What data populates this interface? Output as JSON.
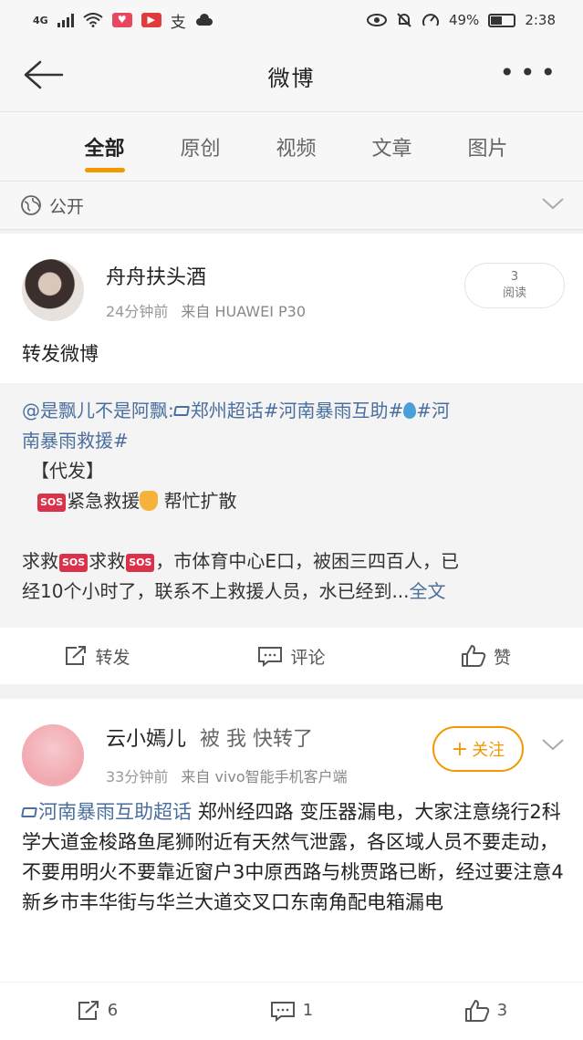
{
  "status_bar": {
    "network": "4G",
    "battery": "49%",
    "time": "2:38"
  },
  "nav": {
    "title": "微博",
    "more": "•••"
  },
  "tabs": [
    {
      "label": "全部",
      "active": true
    },
    {
      "label": "原创",
      "active": false
    },
    {
      "label": "视频",
      "active": false
    },
    {
      "label": "文章",
      "active": false
    },
    {
      "label": "图片",
      "active": false
    }
  ],
  "visibility": {
    "label": "公开"
  },
  "post1": {
    "username": "舟舟扶头酒",
    "time": "24分钟前",
    "source": "来自 HUAWEI P30",
    "read_count": "3",
    "read_label": "阅读",
    "text": "转发微博",
    "quoted": {
      "mention": "@是飘儿不是阿飘",
      "colon": ":",
      "topic_super": "郑州超话",
      "tag1": "#河南暴雨互助#",
      "tag2_a": "#河",
      "tag2_b": "南暴雨救援#",
      "line_bracket": "【代发】",
      "line_help_a": "紧急救援",
      "line_help_b": "帮忙扩散",
      "body_a": "求救",
      "body_b": "求救",
      "body_c": "，市体育中心E口，被困三四百人，已",
      "body_d": "经10个小时了，联系不上救援人员，水已经到...",
      "full_text": "全文",
      "sos": "SOS"
    },
    "actions": {
      "repost": "转发",
      "comment": "评论",
      "like": "赞"
    }
  },
  "post2": {
    "username": "云小嫣儿",
    "suffix": "被 我 快转了",
    "time": "33分钟前",
    "source": "来自 vivo智能手机客户端",
    "follow": "关注",
    "topic": "河南暴雨互助超话",
    "body": "郑州经四路 变压器漏电，大家注意绕行2科学大道金梭路鱼尾狮附近有天然气泄露，各区域人员不要走动，不要用明火不要靠近窗户3中原西路与桃贾路已断，经过要注意4新乡市丰华街与华兰大道交叉口东南角配电箱漏电",
    "actions": {
      "repost_count": "6",
      "comment_count": "1",
      "like_count": "3"
    }
  },
  "colors": {
    "accent": "#f39800",
    "link": "#4a6f9f",
    "sos": "#d9334c"
  },
  "icons": [
    "back-arrow-icon",
    "more-icon",
    "globe-icon",
    "chevron-down-icon",
    "repost-icon",
    "comment-icon",
    "like-icon",
    "diamond-topic-icon",
    "water-drop-icon",
    "hand-down-icon",
    "sos-icon",
    "plus-icon"
  ]
}
